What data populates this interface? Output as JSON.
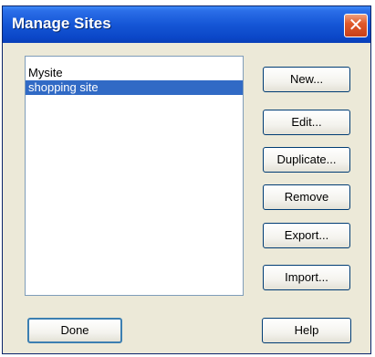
{
  "window": {
    "title": "Manage Sites"
  },
  "sites": [
    {
      "label": "Mysite",
      "selected": false
    },
    {
      "label": "shopping site",
      "selected": true
    }
  ],
  "buttons": {
    "new": "New...",
    "edit": "Edit...",
    "duplicate": "Duplicate...",
    "remove": "Remove",
    "export": "Export...",
    "import": "Import...",
    "done": "Done",
    "help": "Help"
  },
  "colors": {
    "titlebar": "#1556d6",
    "selection": "#316ac5",
    "dialog_bg": "#ece9d8"
  }
}
